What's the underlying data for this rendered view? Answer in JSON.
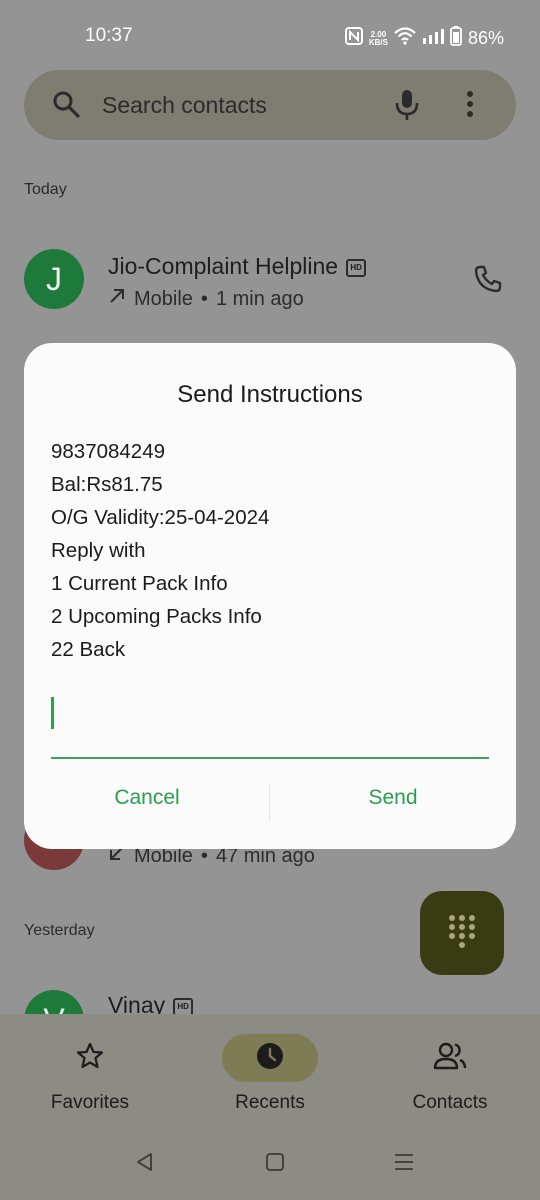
{
  "status_bar": {
    "time": "10:37",
    "speed_value": "2.00",
    "speed_unit": "KB/S",
    "battery": "86%"
  },
  "search": {
    "placeholder": "Search contacts"
  },
  "sections": {
    "today": "Today",
    "yesterday": "Yesterday"
  },
  "calls": [
    {
      "initial": "J",
      "name": "Jio-Complaint Helpline",
      "type": "Mobile",
      "time": "1 min ago",
      "direction": "outgoing",
      "avatar_color": "#1e7a3a"
    },
    {
      "initial": "",
      "name": "",
      "type": "Mobile",
      "time": "47 min ago",
      "direction": "incoming",
      "avatar_color": "#7a3a3a"
    },
    {
      "initial": "V",
      "name": "Vinay",
      "type": "",
      "time": "",
      "direction": "",
      "avatar_color": "#1e7a3a"
    }
  ],
  "dialog": {
    "title": "Send Instructions",
    "lines": [
      "9837084249",
      "Bal:Rs81.75",
      "O/G Validity:25-04-2024",
      "Reply with",
      "1 Current Pack Info",
      "2 Upcoming Packs Info",
      "22 Back"
    ],
    "input_value": "",
    "cancel_label": "Cancel",
    "send_label": "Send",
    "accent_color": "#2a9d4e"
  },
  "nav": {
    "favorites": "Favorites",
    "recents": "Recents",
    "contacts": "Contacts",
    "active": "recents"
  }
}
